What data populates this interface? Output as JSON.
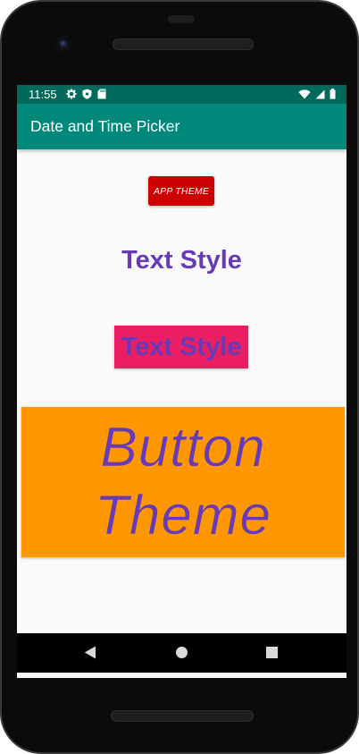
{
  "status_bar": {
    "time": "11:55",
    "left_icons": [
      "gear-icon",
      "shield-icon",
      "sd-card-icon"
    ],
    "right_icons": [
      "wifi-icon",
      "signal-icon",
      "battery-icon"
    ]
  },
  "app_bar": {
    "title": "Date and Time Picker",
    "color": "#00897b",
    "status_color": "#00695c"
  },
  "content": {
    "app_theme_button": {
      "label": "APP THEME",
      "color": "#cc0000"
    },
    "text_style_plain": {
      "label": "Text Style",
      "color": "#673ab7"
    },
    "text_style_boxed": {
      "label": "Text Style",
      "background": "#e91e63"
    },
    "button_theme": {
      "line1": "Button",
      "line2": "Theme",
      "background": "#ff9800"
    }
  },
  "nav_bar": {
    "buttons": [
      "back-icon",
      "home-icon",
      "recents-icon"
    ]
  }
}
